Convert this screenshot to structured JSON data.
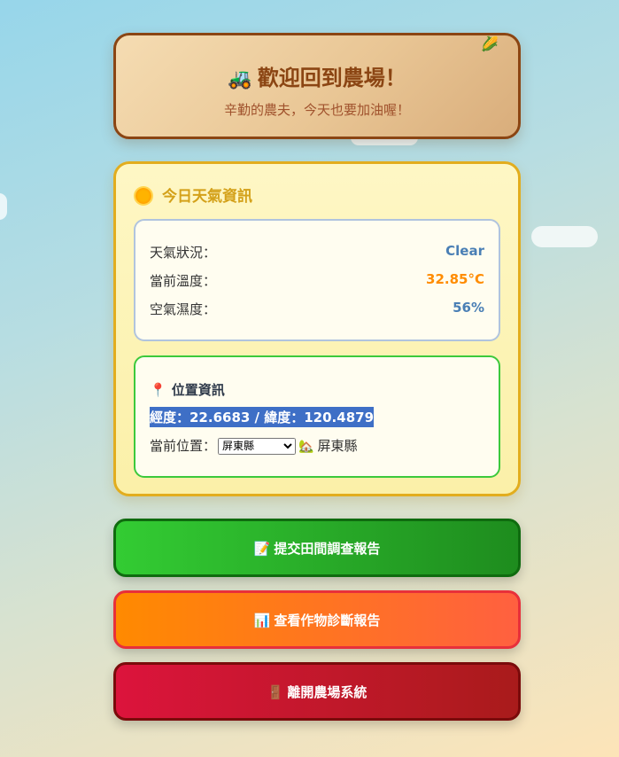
{
  "header": {
    "tractor_icon": "🚜",
    "corner_icon": "🌽",
    "title": "歡迎回到農場！",
    "subtitle": "辛勤的農夫，今天也要加油喔！"
  },
  "weather": {
    "heading": "今日天氣資訊",
    "rows": [
      {
        "label": "天氣狀況：",
        "value": "Clear"
      },
      {
        "label": "當前溫度：",
        "value": "32.85°C"
      },
      {
        "label": "空氣濕度：",
        "value": "56%"
      }
    ]
  },
  "location": {
    "pin_icon": "📍",
    "heading": "位置資訊",
    "coordinates": "經度：22.6683 / 緯度：120.4879",
    "current_label": "當前位置：",
    "selected_county": "屏東縣",
    "house_icon": "🏡",
    "display_name": "屏東縣"
  },
  "buttons": {
    "survey": {
      "icon": "📝",
      "label": "提交田間調查報告"
    },
    "diagnosis": {
      "icon": "📊",
      "label": "查看作物診斷報告"
    },
    "exit": {
      "icon": "🚪",
      "label": "離開農場系統"
    }
  },
  "colors": {
    "header_border": "#8b4513",
    "weather_border": "#e2ad1e",
    "location_border": "#3cc93c",
    "survey_button": "#33cc33",
    "diagnosis_button": "#ff8a00",
    "exit_button": "#dc143c"
  }
}
